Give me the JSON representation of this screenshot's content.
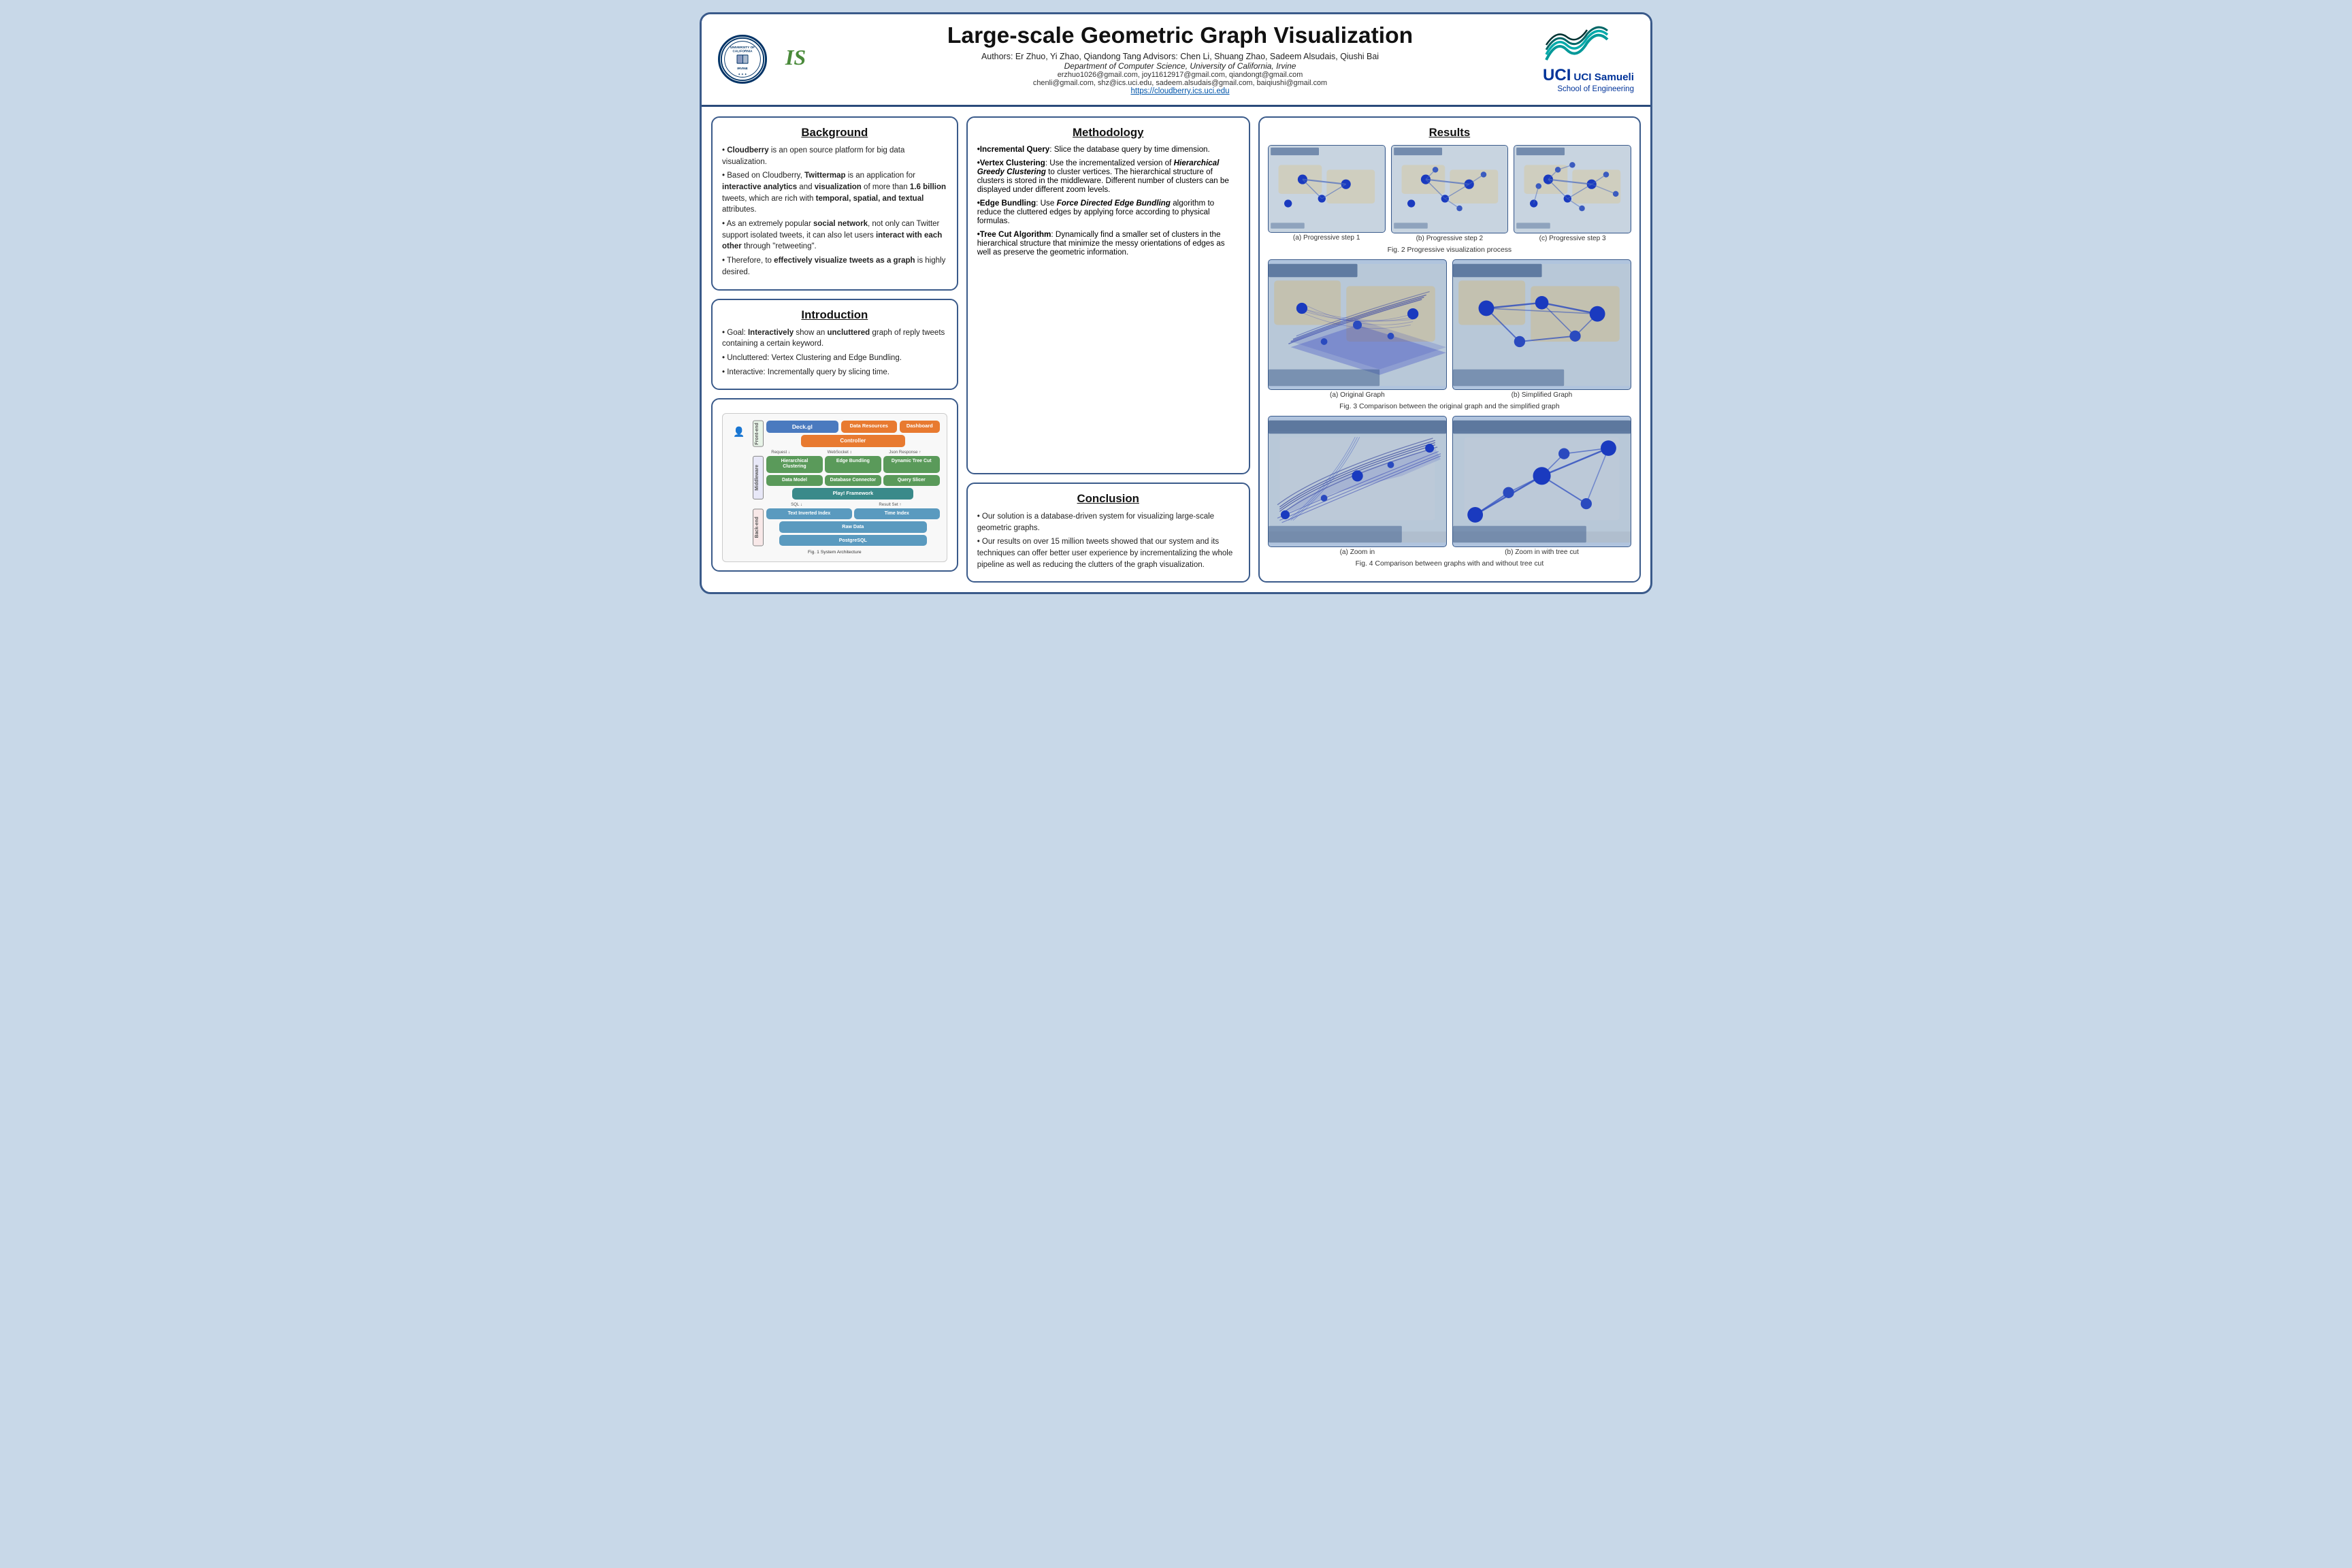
{
  "header": {
    "title": "Large-scale Geometric Graph Visualization",
    "authors": "Authors: Er Zhuo, Yi Zhao, Qiandong Tang    Advisors: Chen Li, Shuang Zhao, Sadeem Alsudais, Qiushi Bai",
    "dept": "Department of Computer Science, University of California, Irvine",
    "emails1": "erzhuo1026@gmail.com, joy11612917@gmail.com, qiandongt@gmail.com",
    "emails2": "chenli@gmail.com, shz@ics.uci.edu, sadeem.alsudais@gmail.com, baiqiushi@gmail.com",
    "url": "https://cloudberry.ics.uci.edu",
    "uci_label": "UCI Samueli",
    "school_label": "School of Engineering"
  },
  "background": {
    "title": "Background",
    "items": [
      {
        "text": "Cloudberry",
        "bold": true,
        "rest": " is an open source platform for big data visualization."
      },
      {
        "text": "Based on Cloudberry, ",
        "bold": false,
        "bold_word": "Twittermap",
        "rest": " is an application for ",
        "bold2": "interactive analytics",
        "rest2": " and ",
        "bold3": "visualization",
        "rest3": " of more than ",
        "bold4": "1.6 billion",
        "rest4": " tweets, which are rich with ",
        "bold5": "temporal, spatial, and textual",
        "rest5": " attributes."
      },
      {
        "text": "As an extremely popular ",
        "bold_word": "social network",
        "rest": ", not only can Twitter support isolated tweets, it can also let users ",
        "bold2": "interact with each other",
        "rest2": " through \"retweeting\"."
      },
      {
        "text": "Therefore, to ",
        "bold_word": "effectively visualize tweets as a graph",
        "rest": " is highly desired."
      }
    ]
  },
  "introduction": {
    "title": "Introduction",
    "items": [
      "Goal: Interactively show an uncluttered graph of reply tweets containing a certain keyword.",
      "Uncluttered: Vertex Clustering and Edge Bundling.",
      "Interactive: Incrementally query by slicing time."
    ]
  },
  "methodology": {
    "title": "Methodology",
    "items": [
      {
        "label": "Incremental Query",
        "rest": ": Slice the database query by time dimension."
      },
      {
        "label": "Vertex Clustering",
        "rest": ": Use the incrementalized version of ",
        "italic": "Hierarchical Greedy Clustering",
        "rest2": " to cluster vertices. The hierarchical structure of clusters is stored in the middleware. Different number of clusters can be displayed under different zoom levels."
      },
      {
        "label": "Edge Bundling",
        "rest": ": Use ",
        "italic": "Force Directed Edge Bundling",
        "rest2": " algorithm to reduce the cluttered edges by applying force according to physical formulas."
      },
      {
        "label": "Tree Cut Algorithm",
        "rest": ":  Dynamically find a smaller set of clusters in the hierarchical structure that minimize the messy orientations of edges as well as preserve the geometric information."
      }
    ]
  },
  "conclusion": {
    "title": "Conclusion",
    "items": [
      "Our solution is a database-driven system for visualizing large-scale geometric graphs.",
      "Our results on over 15 million tweets showed that our system and its techniques can offer better user experience by incrementalizing the whole pipeline as well as reducing the clutters of the graph visualization."
    ]
  },
  "architecture": {
    "fig_caption": "Fig. 1  System Architecture",
    "user_label": "User",
    "layers": {
      "frontend": "Front-end",
      "middleware": "Middleware",
      "backend": "Back-end"
    },
    "boxes": {
      "deckgl": "Deck.gl",
      "data_resources": "Data Resources",
      "dashboard": "Dashboard",
      "controller": "Controller",
      "request": "Request",
      "websocket": "WebSocket",
      "json_response": "Json Response",
      "hierarchical_clustering": "Hierarchical Clustering",
      "edge_bundling": "Edge Bundling",
      "dynamic_tree_cut": "Dynamic Tree Cut",
      "data_model": "Data Model",
      "database_connector": "Database Connector",
      "query_slicer": "Query Slicer",
      "play_framework": "Play! Framework",
      "sql": "SQL",
      "result_set": "Result Set",
      "text_inverted_index": "Text Inverted Index",
      "time_index": "Time Index",
      "raw_data": "Raw Data",
      "postgresql": "PostgreSQL"
    }
  },
  "results": {
    "title": "Results",
    "fig2_caption": "Fig. 2 Progressive visualization process",
    "fig3_caption": "Fig. 3  Comparison between the original graph and the simplified graph",
    "fig4_caption": "Fig. 4  Comparison between graphs with and without tree cut",
    "step1": "(a) Progressive step 1",
    "step2": "(b) Progressive step 2",
    "step3": "(c) Progressive step 3",
    "orig_graph": "(a) Original Graph",
    "simplified_graph": "(b) Simplified Graph",
    "zoom_in": "(a) Zoom in",
    "zoom_tree": "(b) Zoom in with tree cut"
  }
}
